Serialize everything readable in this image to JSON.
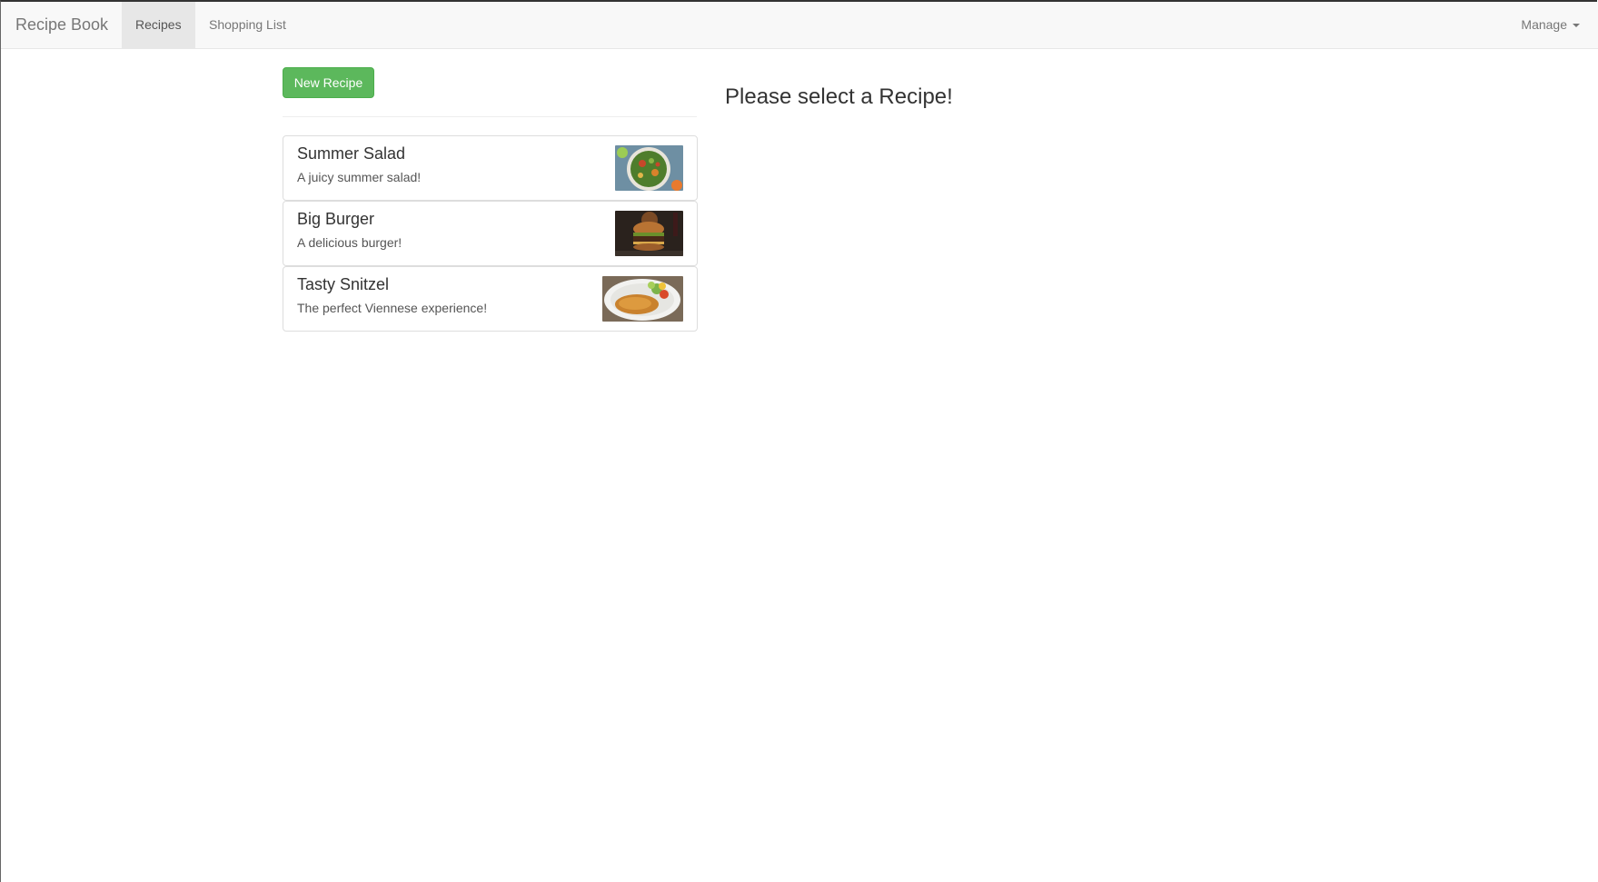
{
  "navbar": {
    "brand": "Recipe Book",
    "tabs": [
      {
        "label": "Recipes",
        "active": true
      },
      {
        "label": "Shopping List",
        "active": false
      }
    ],
    "manage_label": "Manage",
    "manage_icon": "caret-down-icon"
  },
  "recipes": {
    "new_button_label": "New Recipe",
    "items": [
      {
        "name": "Summer Salad",
        "description": "A juicy summer salad!",
        "image": "salad-photo"
      },
      {
        "name": "Big Burger",
        "description": "A delicious burger!",
        "image": "burger-photo"
      },
      {
        "name": "Tasty Snitzel",
        "description": "The perfect Viennese experience!",
        "image": "schnitzel-photo"
      }
    ]
  },
  "detail": {
    "placeholder": "Please select a Recipe!"
  },
  "colors": {
    "success_button": "#5cb85c",
    "navbar_bg": "#f8f8f8",
    "active_tab_bg": "#e7e7e7"
  }
}
